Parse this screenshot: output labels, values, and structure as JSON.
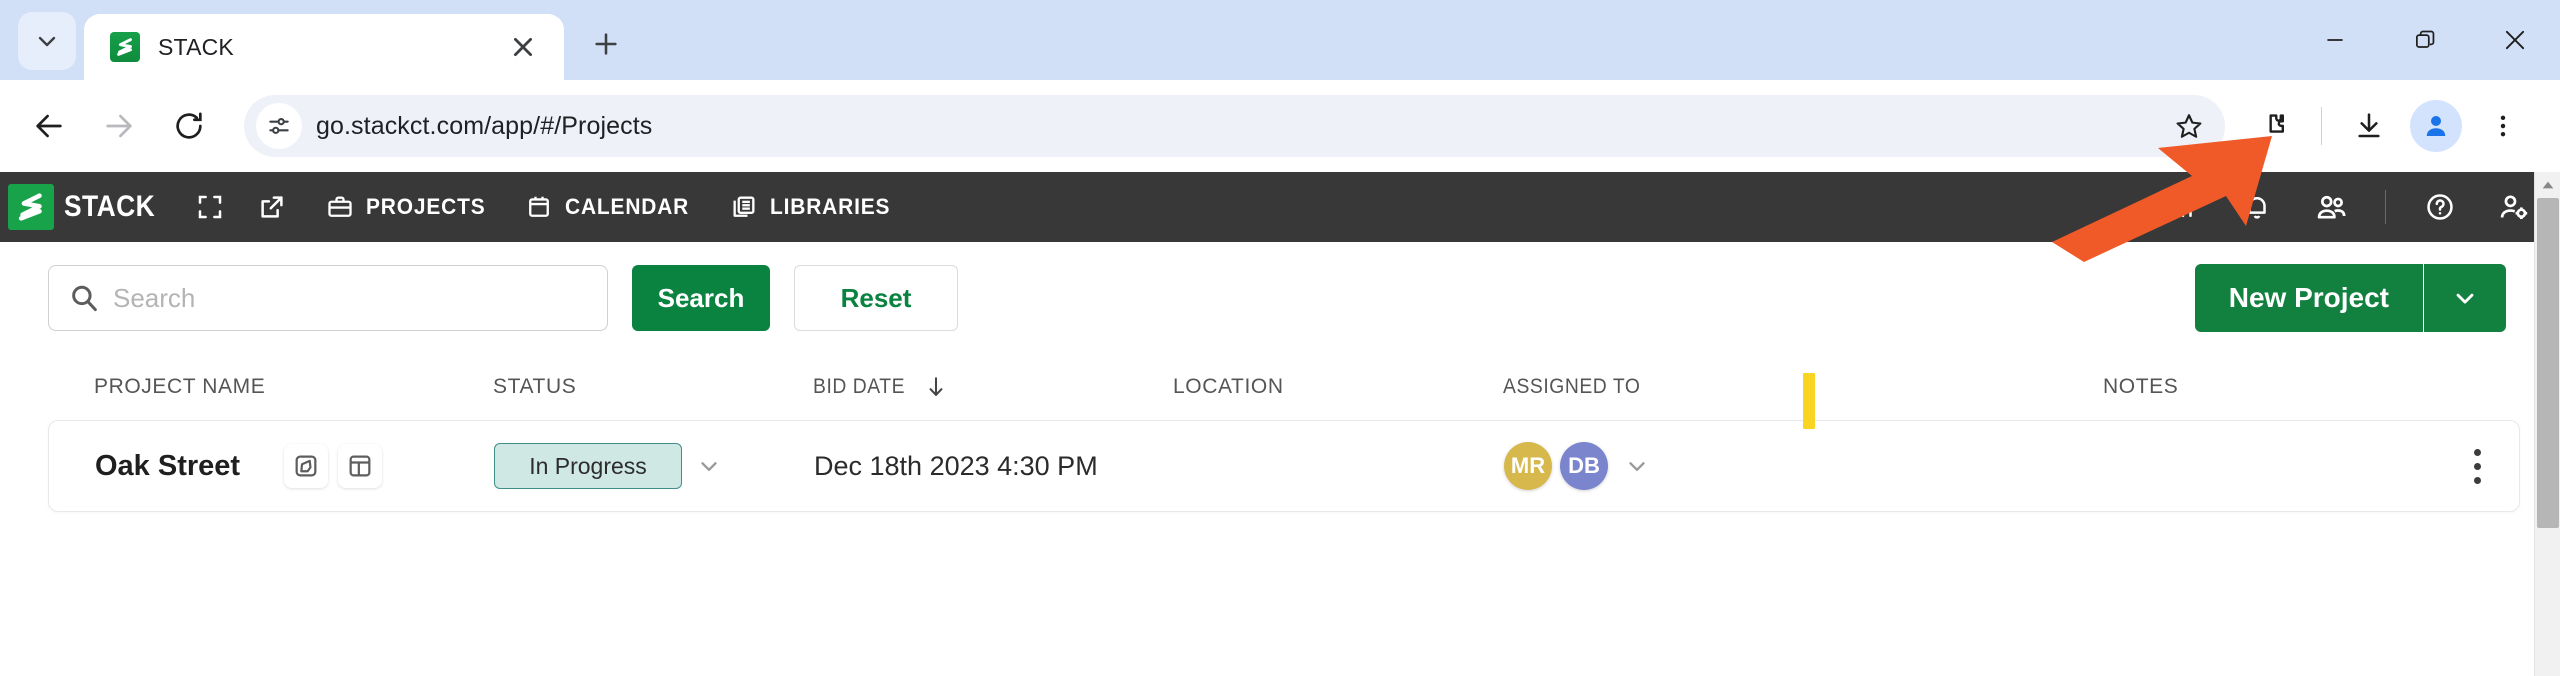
{
  "browser": {
    "tab": {
      "title": "STACK",
      "favicon": "stack-logo-icon",
      "close_label": "×"
    },
    "tab_list_icon": "chevron-down-icon",
    "new_tab_icon": "plus-icon",
    "window_controls": {
      "minimize": "minimize-icon",
      "restore": "restore-icon",
      "close": "close-icon"
    },
    "toolbar": {
      "back_icon": "back-arrow-icon",
      "forward_icon": "forward-arrow-icon",
      "reload_icon": "reload-icon",
      "site_info_icon": "site-settings-icon",
      "url": "go.stackct.com/app/#/Projects",
      "bookmark_icon": "star-icon",
      "extensions_icon": "puzzle-piece-icon",
      "downloads_icon": "download-icon",
      "profile_icon": "person-icon",
      "menu_icon": "three-dot-menu-icon"
    }
  },
  "appnav": {
    "brand": "STACK",
    "brand_mark": "stack-logo-icon",
    "expand_icon": "fullscreen-icon",
    "popout_icon": "open-external-icon",
    "links": [
      {
        "label": "PROJECTS",
        "icon": "briefcase-icon"
      },
      {
        "label": "CALENDAR",
        "icon": "calendar-icon"
      },
      {
        "label": "LIBRARIES",
        "icon": "library-icon"
      }
    ],
    "right_icons": [
      {
        "name": "reports-bar-chart-icon"
      },
      {
        "name": "notification-bell-icon"
      },
      {
        "name": "people-icon"
      },
      {
        "name": "help-circle-icon"
      },
      {
        "name": "user-settings-icon"
      }
    ]
  },
  "controls": {
    "search_placeholder": "Search",
    "search_value": "",
    "search_icon": "magnifier-icon",
    "search_button": "Search",
    "reset_button": "Reset",
    "new_project_button": "New Project",
    "new_project_caret_icon": "chevron-down-icon"
  },
  "table": {
    "headers": {
      "project_name": "PROJECT NAME",
      "status": "STATUS",
      "bid_date": "BID DATE",
      "bid_date_sort_icon": "sort-arrow-down-icon",
      "location": "LOCATION",
      "assigned_to": "ASSIGNED TO",
      "notes": "NOTES"
    },
    "marker_color": "#f9d423",
    "rows": [
      {
        "project_name": "Oak Street",
        "icon_buttons": [
          {
            "name": "takeoff-polygon-icon"
          },
          {
            "name": "plan-layout-icon"
          }
        ],
        "status": "In Progress",
        "status_caret_icon": "chevron-down-icon",
        "bid_date": "Dec 18th 2023 4:30 PM",
        "location": "",
        "assigned_to": [
          {
            "initials": "MR",
            "color": "#d6b84d"
          },
          {
            "initials": "DB",
            "color": "#7b85cd"
          }
        ],
        "assigned_caret_icon": "chevron-down-icon",
        "notes": "",
        "menu_icon": "kebab-menu-icon"
      }
    ]
  },
  "scrollbar": {
    "up_arrow_icon": "scroll-up-arrow-icon"
  },
  "annotation": {
    "arrow": "orange-pointer-arrow",
    "color": "#F05A28",
    "points_at": "extensions-icon"
  },
  "colors": {
    "brand_green": "#12813f",
    "nav_dark": "#383838",
    "tabstrip_blue": "#d2e0f7",
    "status_teal_bg": "#cfe8e4",
    "status_teal_border": "#3f8f88"
  }
}
